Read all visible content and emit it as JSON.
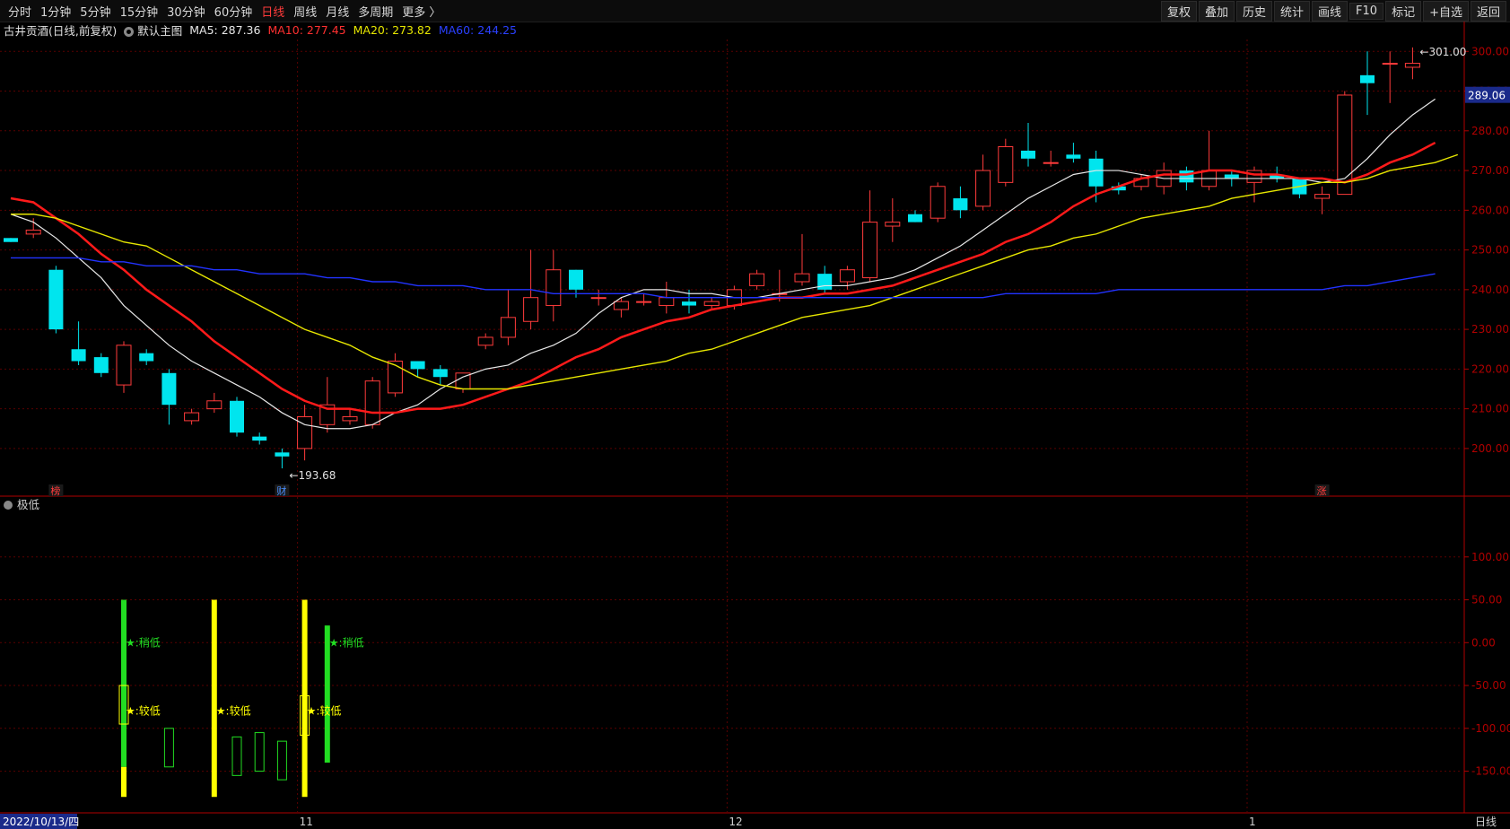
{
  "toolbar": {
    "periods": [
      "分时",
      "1分钟",
      "5分钟",
      "15分钟",
      "30分钟",
      "60分钟",
      "日线",
      "周线",
      "月线",
      "多周期",
      "更多 〉"
    ],
    "active_period": "日线",
    "actions": [
      "复权",
      "叠加",
      "历史",
      "统计",
      "画线",
      "F10",
      "标记",
      "+自选",
      "返回"
    ]
  },
  "info": {
    "stock": "古井贡酒(日线,前复权)",
    "main_label": "默认主图",
    "ma5": "MA5: 287.36",
    "ma10": "MA10: 277.45",
    "ma20": "MA20: 273.82",
    "ma60": "MA60: 244.25"
  },
  "colors": {
    "up": "#ff3b3b",
    "down": "#00e5ee",
    "ma5": "#e8e8e8",
    "ma10": "#ff1a1a",
    "ma20": "#e6e600",
    "ma60": "#2233ff",
    "grid": "#5a0000",
    "axis": "#b00000",
    "bar_green": "#22dd22",
    "bar_yellow": "#ffff00"
  },
  "chart_data": [
    {
      "type": "candlestick",
      "y_axis_ticks": [
        200,
        210,
        220,
        230,
        240,
        250,
        260,
        270,
        280,
        290,
        300
      ],
      "ylim": [
        188,
        303
      ],
      "current_price": "289.06",
      "high_label": "301.00",
      "low_label": "193.68",
      "x_tick_labels": [
        "2022/10/13/四",
        "11",
        "12",
        "1"
      ],
      "period_label": "日线",
      "event_markers": [
        "榜",
        "财",
        "涨"
      ],
      "candles": [
        [
          253,
          252,
          253,
          252
        ],
        [
          254,
          255,
          258,
          253
        ],
        [
          245,
          230,
          246,
          229
        ],
        [
          225,
          222,
          232,
          221
        ],
        [
          223,
          219,
          224,
          218
        ],
        [
          216,
          226,
          227,
          214
        ],
        [
          224,
          222,
          225,
          221
        ],
        [
          219,
          211,
          220,
          206
        ],
        [
          207,
          209,
          210,
          206
        ],
        [
          210,
          212,
          214,
          209
        ],
        [
          212,
          204,
          213,
          203
        ],
        [
          203,
          202,
          204,
          201
        ],
        [
          199,
          198,
          200,
          195
        ],
        [
          200,
          208,
          211,
          197
        ],
        [
          206,
          211,
          218,
          204
        ],
        [
          207,
          208,
          210,
          206
        ],
        [
          206,
          217,
          218,
          205
        ],
        [
          214,
          222,
          224,
          213
        ],
        [
          222,
          220,
          222,
          218
        ],
        [
          220,
          218,
          221,
          216
        ],
        [
          215,
          219,
          219,
          214
        ],
        [
          226,
          228,
          229,
          225
        ],
        [
          228,
          233,
          240,
          226
        ],
        [
          232,
          238,
          250,
          230
        ],
        [
          236,
          245,
          250,
          232
        ],
        [
          245,
          240,
          245,
          238
        ],
        [
          238,
          238,
          240,
          236
        ],
        [
          235,
          237,
          238,
          233
        ],
        [
          237,
          237,
          239,
          236
        ],
        [
          236,
          238,
          242,
          234
        ],
        [
          237,
          236,
          240,
          234
        ],
        [
          236,
          237,
          238,
          235
        ],
        [
          236,
          240,
          241,
          235
        ],
        [
          241,
          244,
          245,
          240
        ],
        [
          239,
          239,
          245,
          237
        ],
        [
          242,
          244,
          254,
          241
        ],
        [
          244,
          240,
          246,
          239
        ],
        [
          242,
          245,
          246,
          240
        ],
        [
          243,
          257,
          265,
          242
        ],
        [
          256,
          257,
          263,
          252
        ],
        [
          259,
          257,
          260,
          257
        ],
        [
          258,
          266,
          267,
          257
        ],
        [
          263,
          260,
          266,
          258
        ],
        [
          261,
          270,
          274,
          260
        ],
        [
          267,
          276,
          278,
          266
        ],
        [
          275,
          273,
          282,
          271
        ],
        [
          272,
          272,
          275,
          271
        ],
        [
          274,
          273,
          277,
          272
        ],
        [
          273,
          266,
          275,
          262
        ],
        [
          266,
          265,
          267,
          264
        ],
        [
          266,
          268,
          269,
          265
        ],
        [
          266,
          270,
          272,
          264
        ],
        [
          270,
          267,
          271,
          265
        ],
        [
          266,
          270,
          280,
          265
        ],
        [
          269,
          268,
          270,
          266
        ],
        [
          267,
          270,
          271,
          262
        ],
        [
          269,
          268,
          271,
          267
        ],
        [
          268,
          264,
          268,
          263
        ],
        [
          263,
          264,
          266,
          259
        ],
        [
          264,
          289,
          290,
          264
        ],
        [
          294,
          292,
          300,
          284
        ],
        [
          297,
          297,
          300,
          287
        ],
        [
          296,
          297,
          301,
          293
        ]
      ],
      "ma_lines": {
        "MA5": [
          259,
          257,
          253,
          248,
          243,
          236,
          231,
          226,
          222,
          219,
          216,
          213,
          209,
          206,
          205,
          205,
          206,
          209,
          211,
          215,
          218,
          220,
          221,
          224,
          226,
          229,
          234,
          238,
          240,
          240,
          239,
          239,
          238,
          238,
          239,
          240,
          241,
          241,
          242,
          243,
          245,
          248,
          251,
          255,
          259,
          263,
          266,
          269,
          270,
          270,
          269,
          268,
          268,
          268,
          268,
          268,
          268,
          268,
          267,
          268,
          273,
          279,
          284,
          288
        ],
        "MA10": [
          263,
          262,
          258,
          254,
          249,
          245,
          240,
          236,
          232,
          227,
          223,
          219,
          215,
          212,
          210,
          210,
          209,
          209,
          210,
          210,
          211,
          213,
          215,
          217,
          220,
          223,
          225,
          228,
          230,
          232,
          233,
          235,
          236,
          237,
          238,
          238,
          239,
          239,
          240,
          241,
          243,
          245,
          247,
          249,
          252,
          254,
          257,
          261,
          264,
          266,
          268,
          269,
          269,
          270,
          270,
          269,
          269,
          268,
          268,
          267,
          269,
          272,
          274,
          277
        ],
        "MA20": [
          259,
          259,
          258,
          256,
          254,
          252,
          251,
          248,
          245,
          242,
          239,
          236,
          233,
          230,
          228,
          226,
          223,
          221,
          218,
          216,
          215,
          215,
          215,
          216,
          217,
          218,
          219,
          220,
          221,
          222,
          224,
          225,
          227,
          229,
          231,
          233,
          234,
          235,
          236,
          238,
          240,
          242,
          244,
          246,
          248,
          250,
          251,
          253,
          254,
          256,
          258,
          259,
          260,
          261,
          263,
          264,
          265,
          266,
          267,
          267,
          268,
          270,
          271,
          272,
          274
        ],
        "MA60": [
          248,
          248,
          248,
          248,
          247,
          247,
          246,
          246,
          246,
          245,
          245,
          244,
          244,
          244,
          243,
          243,
          242,
          242,
          241,
          241,
          241,
          240,
          240,
          240,
          239,
          239,
          239,
          239,
          239,
          238,
          238,
          238,
          238,
          238,
          238,
          238,
          238,
          238,
          238,
          238,
          238,
          238,
          238,
          238,
          239,
          239,
          239,
          239,
          239,
          240,
          240,
          240,
          240,
          240,
          240,
          240,
          240,
          240,
          240,
          241,
          241,
          242,
          243,
          244
        ]
      }
    },
    {
      "type": "bar",
      "indicator_label": "极低",
      "y_axis_ticks": [
        100,
        50,
        0,
        -50,
        -100,
        -150
      ],
      "ylim": [
        -185,
        150
      ],
      "annotations": [
        "★:稍低",
        "★:较低",
        "★:较低",
        "★:较低",
        "★:稍低"
      ],
      "bars": [
        {
          "index": 5,
          "kind": "solid_green_yellow",
          "top": 50,
          "bottom": -180,
          "split": -145
        },
        {
          "index": 5,
          "kind": "hollow_yellow",
          "top": -50,
          "bottom": -95
        },
        {
          "index": 7,
          "kind": "hollow_green",
          "top": -100,
          "bottom": -145
        },
        {
          "index": 9,
          "kind": "solid_yellow",
          "top": 50,
          "bottom": -180
        },
        {
          "index": 10,
          "kind": "hollow_green",
          "top": -110,
          "bottom": -155
        },
        {
          "index": 11,
          "kind": "hollow_green",
          "top": -105,
          "bottom": -150
        },
        {
          "index": 12,
          "kind": "hollow_green",
          "top": -115,
          "bottom": -160
        },
        {
          "index": 13,
          "kind": "solid_yellow",
          "top": 50,
          "bottom": -180
        },
        {
          "index": 13,
          "kind": "hollow_yellow",
          "top": -62,
          "bottom": -108
        },
        {
          "index": 14,
          "kind": "solid_green",
          "top": 20,
          "bottom": -140
        }
      ]
    }
  ]
}
